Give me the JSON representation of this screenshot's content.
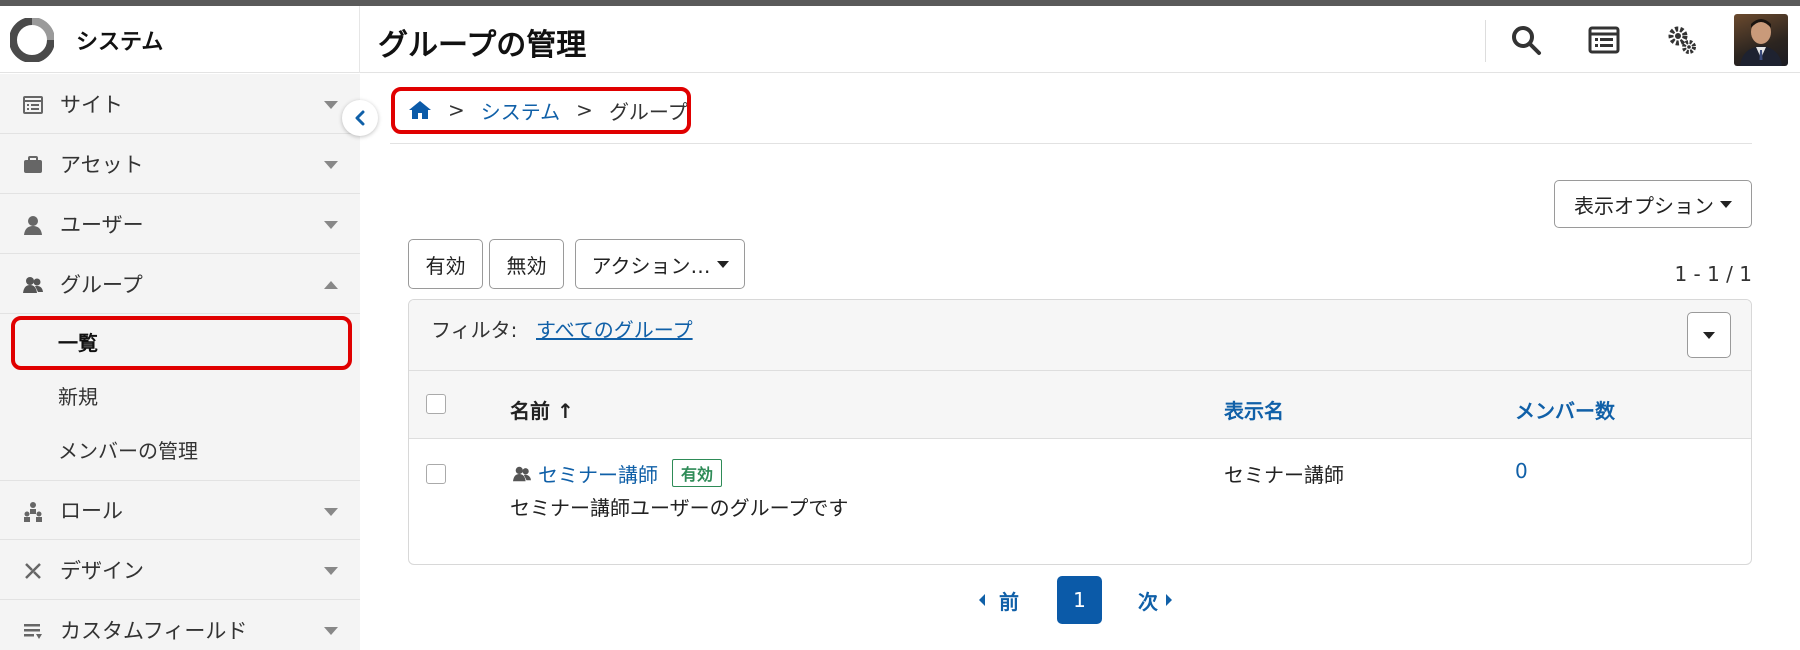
{
  "brand": {
    "name": "システム"
  },
  "header": {
    "title": "グループの管理"
  },
  "sidebar": {
    "items": [
      {
        "label": "サイト",
        "icon": "site-icon"
      },
      {
        "label": "アセット",
        "icon": "briefcase-icon"
      },
      {
        "label": "ユーザー",
        "icon": "user-icon"
      },
      {
        "label": "グループ",
        "icon": "group-icon"
      },
      {
        "label": "ロール",
        "icon": "role-icon"
      },
      {
        "label": "デザイン",
        "icon": "design-icon"
      },
      {
        "label": "カスタムフィールド",
        "icon": "custom-field-icon"
      }
    ],
    "subitems": [
      {
        "label": "一覧"
      },
      {
        "label": "新規"
      },
      {
        "label": "メンバーの管理"
      }
    ]
  },
  "breadcrumb": {
    "sep": ">",
    "level1": "システム",
    "current": "グループ"
  },
  "toolbar": {
    "display_options": "表示オプション",
    "enable": "有効",
    "disable": "無効",
    "actions": "アクション…"
  },
  "count": "1 - 1 / 1",
  "filter": {
    "label": "フィルタ:",
    "value": "すべてのグループ"
  },
  "table": {
    "columns": {
      "name": "名前 ↑",
      "display_name": "表示名",
      "members": "メンバー数"
    },
    "rows": [
      {
        "name": "セミナー講師",
        "status": "有効",
        "description": "セミナー講師ユーザーのグループです",
        "display_name": "セミナー講師",
        "members": "0"
      }
    ]
  },
  "pagination": {
    "prev": "前",
    "page": "1",
    "next": "次"
  },
  "colors": {
    "link": "#1060a8",
    "active_page": "#0b5aa8",
    "highlight": "#e00000",
    "status_ok": "#2e8b57"
  }
}
